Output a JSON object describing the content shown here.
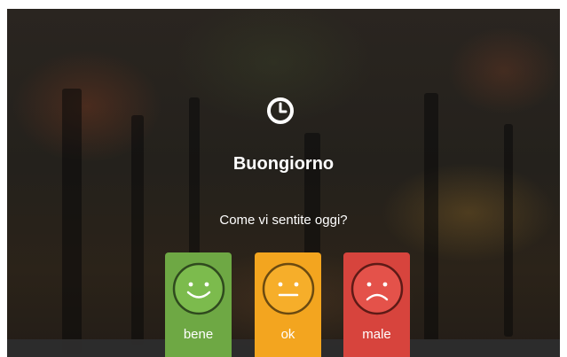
{
  "greeting": {
    "title": "Buongiorno",
    "question": "Come vi sentite oggi?"
  },
  "icons": {
    "header": "clock-icon"
  },
  "moods": [
    {
      "label": "bene",
      "color": "#6ea844",
      "face_color": "#7cbb4d",
      "icon": "happy-face-icon"
    },
    {
      "label": "ok",
      "color": "#f3a51f",
      "face_color": "#f6ae2a",
      "icon": "neutral-face-icon"
    },
    {
      "label": "male",
      "color": "#d7443d",
      "face_color": "#e4524a",
      "icon": "sad-face-icon"
    }
  ]
}
